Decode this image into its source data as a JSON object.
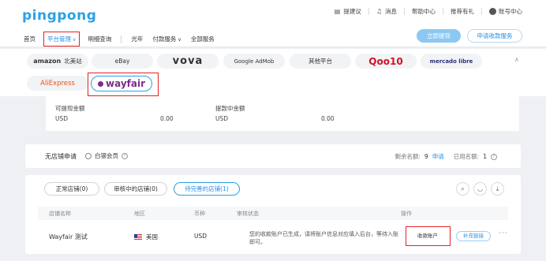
{
  "brand": {
    "logo": "pingpong"
  },
  "topnav": {
    "feedback": "提建议",
    "messages": "消息",
    "help": "帮助中心",
    "rewards": "推荐有礼",
    "account": "账号中心"
  },
  "mainnav": {
    "home": "首页",
    "platform": "平台管理",
    "detail": "明细查询",
    "lightyear": "光年",
    "payment": "付款服务",
    "all": "全部服务"
  },
  "actions": {
    "withdraw": "立即提现",
    "apply_account": "申请收款服务"
  },
  "platforms": {
    "amazon_brand": "amazon",
    "amazon_region": "北美站",
    "ebay": "eBay",
    "vova": "vova",
    "admob": "Google AdMob",
    "other": "其他平台",
    "qoo10": "Qoo10",
    "mercado": "mercado libre",
    "aliexpress": "AliExpress",
    "wayfair": "wayfair"
  },
  "balance": {
    "available_label": "可提现金额",
    "available_currency": "USD",
    "available_value": "0.00",
    "withdrawing_label": "提款中金额",
    "withdrawing_currency": "USD",
    "withdrawing_value": "0.00"
  },
  "apply": {
    "title": "无店铺申请",
    "member": "白银会员",
    "remaining_label": "剩余名额:",
    "remaining_value": "9",
    "apply_link": "申请",
    "used_label": "已用名额:",
    "used_value": "1"
  },
  "tabs": {
    "normal": "正常店铺(0)",
    "reviewing": "审核中的店铺(0)",
    "pending": "待完善的店铺(1)"
  },
  "table": {
    "headers": {
      "name": "店铺名称",
      "region": "地区",
      "currency": "币种",
      "status": "审核状态",
      "action": "操作"
    },
    "rows": [
      {
        "name": "Wayfair 测试",
        "region": "美国",
        "currency": "USD",
        "status": "您的收款账户已生成，请将账户信息对应填入后台，等待入账即可。",
        "action_primary": "收款账户",
        "action_secondary": "补充链接",
        "more": "···"
      }
    ]
  }
}
